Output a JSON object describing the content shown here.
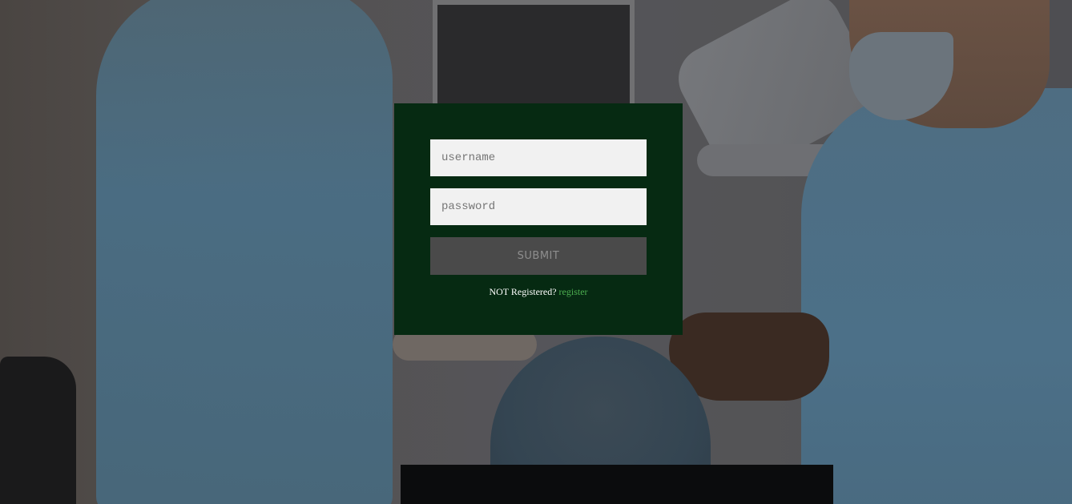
{
  "login_form": {
    "username_placeholder": "username",
    "password_placeholder": "password",
    "submit_label": "SUBMIT",
    "register_prompt": "NOT Registered?",
    "register_link": "register"
  },
  "colors": {
    "panel_background": "#062a12",
    "input_background": "#f1f1f1",
    "submit_background": "#4a4a4a",
    "register_link": "#4caf50"
  },
  "background_image": "dental surgery scene"
}
